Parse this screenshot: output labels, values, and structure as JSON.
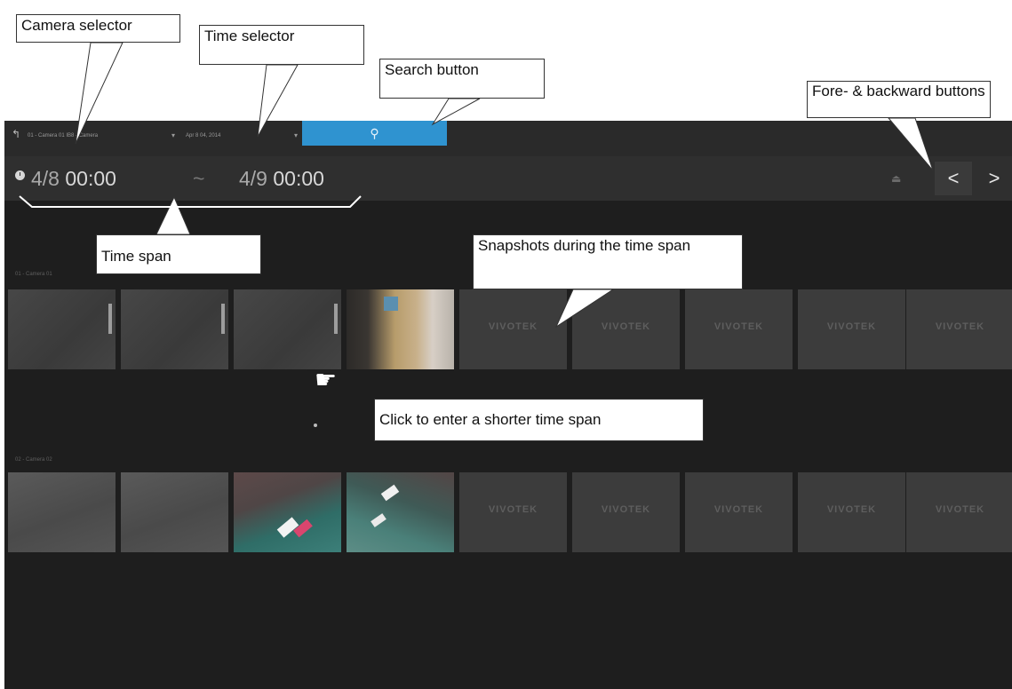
{
  "toolbar": {
    "back_icon": "↰",
    "camera_selector": "01 - Camera 01 IB8 - Camera",
    "camera_caret": "▾",
    "time_selector": "Apr 8 04, 2014",
    "time_caret": "▾",
    "search_icon": "⚲"
  },
  "timerange": {
    "from_date": "4/8",
    "from_time": "00:00",
    "separator": "~",
    "to_date": "4/9",
    "to_time": "00:00",
    "export_icon": "⏏",
    "prev_label": "<",
    "next_label": ">"
  },
  "cameras": [
    {
      "label": "01 - Camera 01"
    },
    {
      "label": "02 - Camera 02"
    }
  ],
  "thumbnail_brand": "VIVOTEK",
  "annotations": {
    "camera_selector": "Camera selector",
    "time_selector": "Time selector",
    "search_button": "Search button",
    "fore_backward": "Fore- & backward buttons",
    "time_span": "Time span",
    "snapshots": "Snapshots during the time span",
    "click_hint": "Click to enter a shorter time span"
  },
  "colors": {
    "search_accent": "#2f93d0",
    "background": "#1e1e1e"
  }
}
